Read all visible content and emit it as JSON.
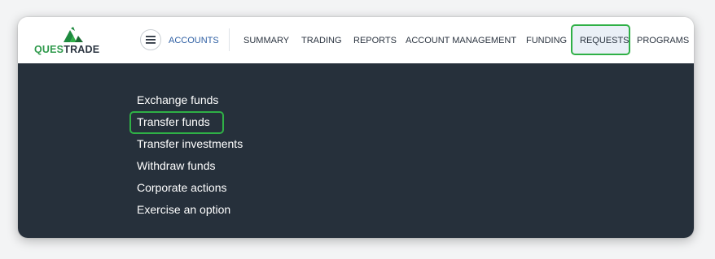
{
  "logo": {
    "prefix": "QUES",
    "suffix": "TRADE",
    "accent_color": "#2f9a4c"
  },
  "header": {
    "menu_icon": "hamburger-icon",
    "accounts_label": "ACCOUNTS",
    "nav": [
      {
        "label": "SUMMARY"
      },
      {
        "label": "TRADING"
      },
      {
        "label": "REPORTS"
      },
      {
        "label": "ACCOUNT MANAGEMENT"
      },
      {
        "label": "FUNDING"
      },
      {
        "label": "REQUESTS",
        "active": true
      },
      {
        "label": "PROGRAMS"
      }
    ]
  },
  "requests_menu": {
    "items": [
      {
        "label": "Exchange funds"
      },
      {
        "label": "Transfer funds",
        "highlighted": true
      },
      {
        "label": "Transfer investments"
      },
      {
        "label": "Withdraw funds"
      },
      {
        "label": "Corporate actions"
      },
      {
        "label": "Exercise an option"
      }
    ]
  },
  "colors": {
    "dropdown_bg": "#26303b",
    "highlight_border": "#2fb046",
    "accounts_link": "#2e5fa3"
  }
}
